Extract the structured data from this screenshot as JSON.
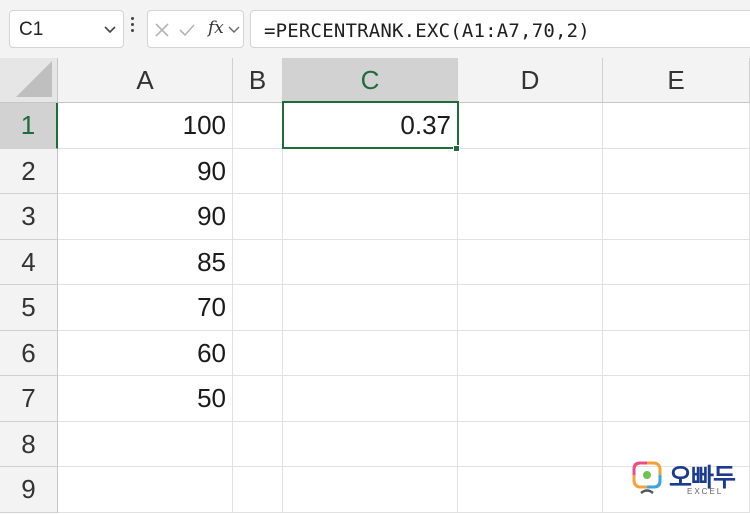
{
  "name_box": {
    "value": "C1"
  },
  "formula_bar": {
    "fx_label": "fx",
    "formula": "=PERCENTRANK.EXC(A1:A7,70,2)"
  },
  "columns": [
    "A",
    "B",
    "C",
    "D",
    "E"
  ],
  "selected_column": "C",
  "rows": [
    {
      "num": "1",
      "A": "100",
      "B": "",
      "C": "0.37",
      "D": "",
      "E": ""
    },
    {
      "num": "2",
      "A": "90",
      "B": "",
      "C": "",
      "D": "",
      "E": ""
    },
    {
      "num": "3",
      "A": "90",
      "B": "",
      "C": "",
      "D": "",
      "E": ""
    },
    {
      "num": "4",
      "A": "85",
      "B": "",
      "C": "",
      "D": "",
      "E": ""
    },
    {
      "num": "5",
      "A": "70",
      "B": "",
      "C": "",
      "D": "",
      "E": ""
    },
    {
      "num": "6",
      "A": "60",
      "B": "",
      "C": "",
      "D": "",
      "E": ""
    },
    {
      "num": "7",
      "A": "50",
      "B": "",
      "C": "",
      "D": "",
      "E": ""
    },
    {
      "num": "8",
      "A": "",
      "B": "",
      "C": "",
      "D": "",
      "E": ""
    },
    {
      "num": "9",
      "A": "",
      "B": "",
      "C": "",
      "D": "",
      "E": ""
    }
  ],
  "selected_row": "1",
  "active_cell": "C1",
  "watermark": {
    "text": "오빠두",
    "subtext": "EXCEL"
  },
  "colors": {
    "accent": "#1e6b3c",
    "header_bg": "#f3f3f3",
    "selected_header_bg": "#d2d2d2",
    "gridline": "#e1e1e1"
  }
}
